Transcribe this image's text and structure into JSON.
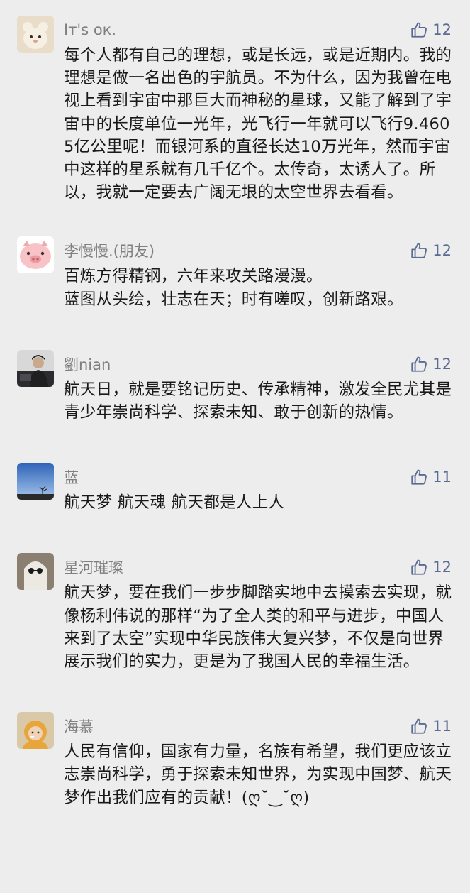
{
  "comments": [
    {
      "nickname": "Iт's ок.",
      "likes": "12",
      "content": "每个人都有自己的理想，或是长远，或是近期内。我的理想是做一名出色的宇航员。不为什么，因为我曾在电视上看到宇宙中那巨大而神秘的星球，又能了解到了宇宙中的长度单位一光年，光飞行一年就可以飞行9.4605亿公里呢！而银河系的直径长达10万光年，然而宇宙中这样的星系就有几千亿个。太传奇，太诱人了。所以，我就一定要去广阔无垠的太空世界去看看。"
    },
    {
      "nickname": "李慢慢.(朋友)",
      "likes": "12",
      "content": "百炼方得精钢，六年来攻关路漫漫。\n蓝图从头绘，壮志在天；时有嗟叹，创新路艰。"
    },
    {
      "nickname": "劉nian",
      "likes": "12",
      "content": "航天日，就是要铭记历史、传承精神，激发全民尤其是青少年崇尚科学、探索未知、敢于创新的热情。"
    },
    {
      "nickname": "蓝",
      "likes": "11",
      "content": "航天梦 航天魂 航天都是人上人"
    },
    {
      "nickname": "星河璀璨",
      "likes": "12",
      "content": "航天梦，要在我们一步步脚踏实地中去摸索去实现，就像杨利伟说的那样“为了全人类的和平与进步，中国人来到了太空”实现中华民族伟大复兴梦，不仅是向世界展示我们的实力，更是为了我国人民的幸福生活。"
    },
    {
      "nickname": "海慕",
      "likes": "11",
      "content": "人民有信仰，国家有力量，名族有希望，我们更应该立志崇尚科学，勇于探索未知世界，为实现中国梦、航天梦作出我们应有的贡献！(ღ˘‿˘ღ)"
    }
  ],
  "icons": {
    "like": "thumbs-up-icon"
  },
  "colors": {
    "background": "#ededed",
    "nickname": "#7f7f7f",
    "like": "#5b6b92",
    "text": "#191919"
  }
}
